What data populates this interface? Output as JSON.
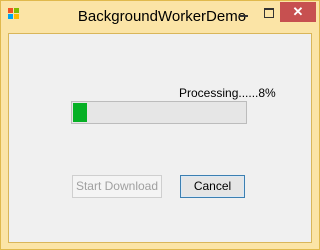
{
  "window": {
    "title": "BackgroundWorkerDemo",
    "close_glyph": "✕",
    "icons": {
      "app": "app-icon",
      "minimize": "minimize-icon",
      "maximize": "maximize-icon",
      "close": "close-icon"
    }
  },
  "status": {
    "text": "Processing......8%"
  },
  "progress": {
    "value_percent": 8,
    "fill_color": "#06b025"
  },
  "buttons": {
    "start_label": "Start Download",
    "start_enabled": false,
    "cancel_label": "Cancel"
  },
  "colors": {
    "frame": "#fbe4a6",
    "close_button": "#c75050",
    "client": "#f0f0f0"
  }
}
